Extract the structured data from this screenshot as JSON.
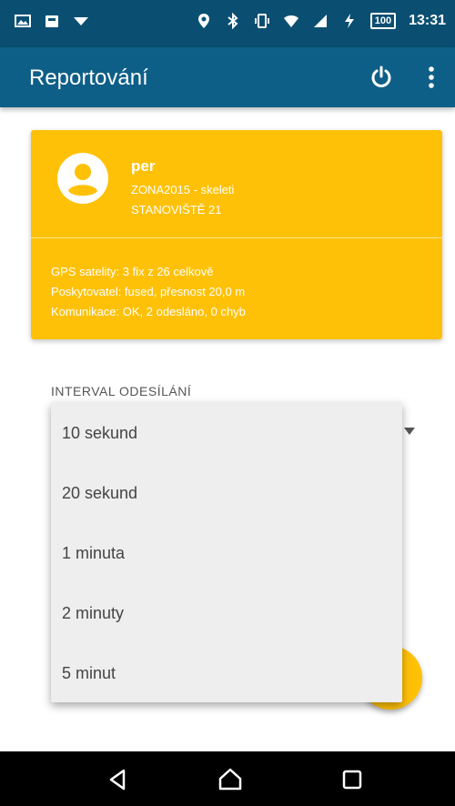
{
  "status_bar": {
    "time": "13:31",
    "battery": "100",
    "left_icons": [
      "gallery-icon",
      "bag-icon",
      "wifi-down-icon"
    ],
    "right_icons": [
      "location-icon",
      "bluetooth-icon",
      "vibrate-icon",
      "wifi-icon",
      "signal-icon",
      "charging-icon"
    ]
  },
  "app_bar": {
    "title": "Reportování",
    "actions": [
      "power-icon",
      "more-vert-icon"
    ]
  },
  "card": {
    "color": "#ffc107",
    "user_name": "per",
    "line1": "ZONA2015 - skeleti",
    "line2": "STANOVIŠTĚ 21",
    "info1": "GPS satelity: 3 fix z 26 celkově",
    "info2": "Poskytovatel: fused, přesnost 20,0 m",
    "info3": "Komunikace: OK, 2 odesláno, 0 chyb"
  },
  "interval": {
    "label": "INTERVAL ODESÍLÁNÍ",
    "options": [
      "10 sekund",
      "20 sekund",
      "1 minuta",
      "2 minuty",
      "5 minut"
    ]
  },
  "colors": {
    "app_bar": "#0e5f88",
    "status_bar": "#0a4f72",
    "accent": "#ffc107",
    "popup": "#eeeeee"
  },
  "nav_bar": {
    "buttons": [
      "back-icon",
      "home-icon",
      "recents-icon"
    ]
  }
}
